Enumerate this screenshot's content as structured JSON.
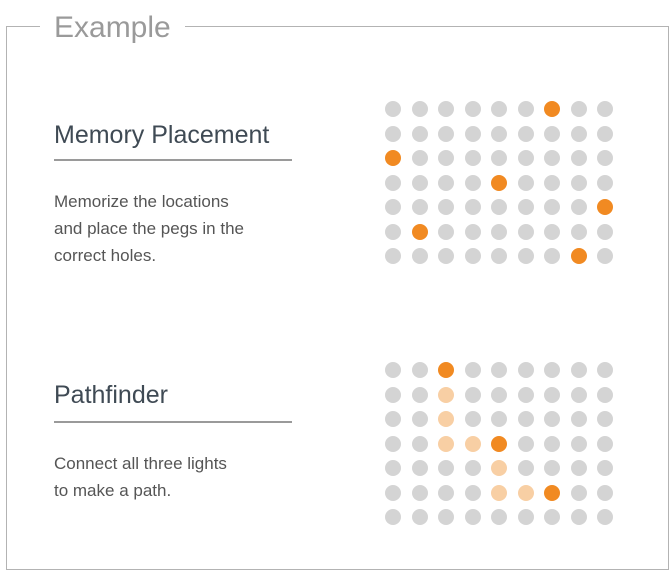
{
  "frame": {
    "title": "Example"
  },
  "colors": {
    "border": "#b3b3b3",
    "title": "#9a9a9a",
    "heading": "#3f4a54",
    "text": "#555555",
    "hole": "#d4d4d4",
    "light": "#f18a22",
    "path": "#f8cfa4"
  },
  "sections": [
    {
      "title": "Memory Placement",
      "desc_lines": [
        "Memorize the locations",
        "and place the pegs in the",
        "correct holes."
      ],
      "grid": {
        "rows": 7,
        "cols": 9,
        "lit": [
          [
            0,
            6
          ],
          [
            2,
            0
          ],
          [
            3,
            4
          ],
          [
            4,
            8
          ],
          [
            5,
            1
          ],
          [
            6,
            7
          ]
        ],
        "path": []
      }
    },
    {
      "title": "Pathfinder",
      "desc_lines": [
        "Connect all three lights",
        "to make a path."
      ],
      "grid": {
        "rows": 7,
        "cols": 9,
        "lit": [
          [
            0,
            2
          ],
          [
            3,
            4
          ],
          [
            5,
            6
          ]
        ],
        "path": [
          [
            1,
            2
          ],
          [
            2,
            2
          ],
          [
            3,
            2
          ],
          [
            3,
            3
          ],
          [
            4,
            4
          ],
          [
            5,
            4
          ],
          [
            5,
            5
          ]
        ]
      }
    }
  ]
}
